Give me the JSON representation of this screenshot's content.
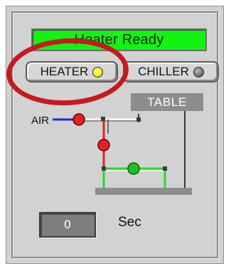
{
  "status": {
    "text": "Heater Ready",
    "color": "#12f312"
  },
  "buttons": {
    "heater": {
      "label": "HEATER",
      "indicator": "led-yellow-on"
    },
    "chiller": {
      "label": "CHILLER",
      "indicator": "led-gray-off"
    }
  },
  "diagram": {
    "table_label": "TABLE",
    "air_label": "AIR",
    "valves": [
      {
        "name": "air-valve",
        "color": "#e02222"
      },
      {
        "name": "vertical-valve",
        "color": "#e02222"
      },
      {
        "name": "bottom-valve",
        "color": "#1fc11f"
      }
    ]
  },
  "timer": {
    "value": "0",
    "unit": "Sec"
  },
  "annotation": {
    "ring_color": "#c7191f"
  }
}
